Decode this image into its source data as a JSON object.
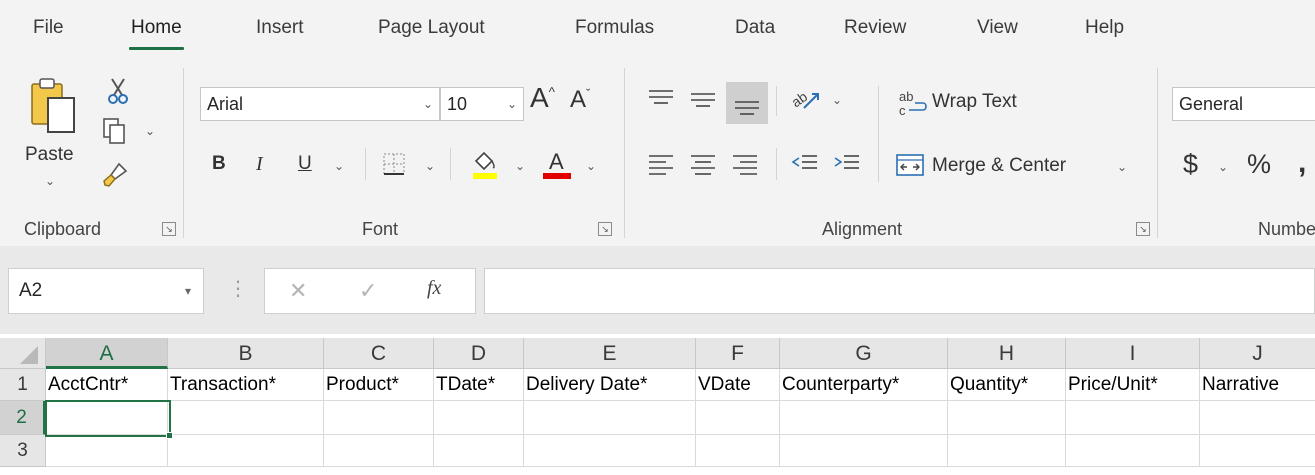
{
  "menu": {
    "tabs": [
      {
        "label": "File"
      },
      {
        "label": "Home"
      },
      {
        "label": "Insert"
      },
      {
        "label": "Page Layout"
      },
      {
        "label": "Formulas"
      },
      {
        "label": "Data"
      },
      {
        "label": "Review"
      },
      {
        "label": "View"
      },
      {
        "label": "Help"
      }
    ],
    "active": "Home"
  },
  "ribbon": {
    "clipboard": {
      "label": "Clipboard",
      "paste_label": "Paste"
    },
    "font": {
      "label": "Font",
      "font_name": "Arial",
      "font_size": "10",
      "bold": "B",
      "italic": "I",
      "underline": "U"
    },
    "alignment": {
      "label": "Alignment",
      "wrap_text": "Wrap Text",
      "merge_center": "Merge & Center"
    },
    "number": {
      "label": "Numbe",
      "format": "General",
      "currency": "$",
      "percent": "%"
    }
  },
  "formula_bar": {
    "name_box": "A2",
    "fx": "fx",
    "content": ""
  },
  "sheet": {
    "columns": [
      "A",
      "B",
      "C",
      "D",
      "E",
      "F",
      "G",
      "H",
      "I",
      "J"
    ],
    "rows": [
      {
        "num": "1",
        "cells": [
          "AcctCntr*",
          "Transaction*",
          "Product*",
          "TDate*",
          "Delivery Date*",
          "VDate",
          "Counterparty*",
          "Quantity*",
          "Price/Unit*",
          "Narrative"
        ]
      },
      {
        "num": "2",
        "cells": [
          "",
          "",
          "",
          "",
          "",
          "",
          "",
          "",
          "",
          ""
        ]
      },
      {
        "num": "3",
        "cells": [
          "",
          "",
          "",
          "",
          "",
          "",
          "",
          "",
          "",
          ""
        ]
      }
    ],
    "selected_cell": "A2"
  },
  "colors": {
    "accent": "#217346",
    "highlight_bar": "#ffff00",
    "font_color_bar": "#e00000"
  },
  "icons": [
    "paste-icon",
    "cut-icon",
    "copy-icon",
    "format-painter-icon",
    "borders-icon",
    "fill-color-icon",
    "font-color-icon",
    "wrap-text-icon",
    "merge-center-icon",
    "orientation-icon"
  ]
}
